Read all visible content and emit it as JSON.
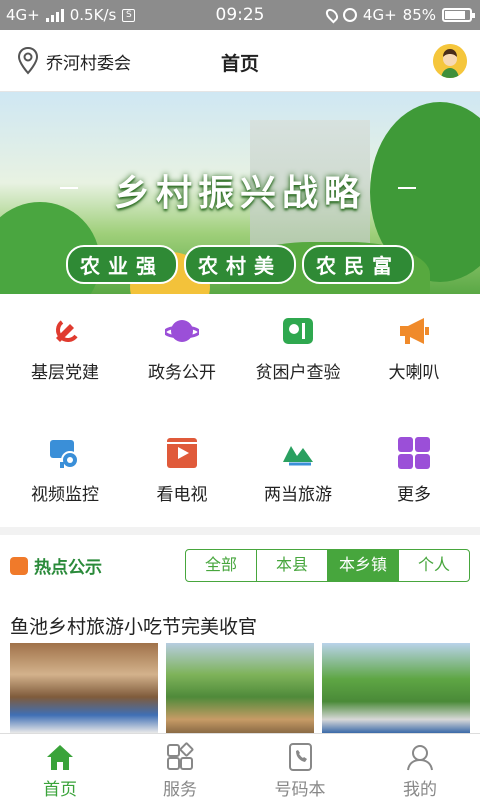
{
  "status_bar": {
    "network_left": "4G+",
    "speed": "0.5K/s",
    "speed_box": "S",
    "time": "09:25",
    "network_right": "4G+",
    "battery": "85%",
    "battery_level": 0.85
  },
  "header": {
    "location": "乔河村委会",
    "title": "首页"
  },
  "banner": {
    "headline": "乡村振兴战略",
    "slogans": [
      "农业强",
      "农村美",
      "农民富"
    ],
    "page_count": 2
  },
  "menu": [
    {
      "label": "基层党建",
      "icon": "party-emblem-icon",
      "color": "#e03b2f"
    },
    {
      "label": "政务公开",
      "icon": "planet-icon",
      "color": "#9b4fd8"
    },
    {
      "label": "贫困户查验",
      "icon": "ticket-icon",
      "color": "#2fa84f"
    },
    {
      "label": "大喇叭",
      "icon": "megaphone-icon",
      "color": "#f08a2a"
    },
    {
      "label": "视频监控",
      "icon": "camera-icon",
      "color": "#3a8fd8"
    },
    {
      "label": "看电视",
      "icon": "video-icon",
      "color": "#e05a3a"
    },
    {
      "label": "两当旅游",
      "icon": "tourism-logo-icon",
      "color": "#2aa060"
    },
    {
      "label": "更多",
      "icon": "grid-icon",
      "color": "#9b4fd8"
    }
  ],
  "hot": {
    "label": "热点公示",
    "tabs": [
      "全部",
      "本县",
      "本乡镇",
      "个人"
    ],
    "active_tab": "本乡镇",
    "news_title": "鱼池乡村旅游小吃节完美收官"
  },
  "bottom_nav": [
    {
      "label": "首页",
      "icon": "home-icon",
      "active": true
    },
    {
      "label": "服务",
      "icon": "services-icon",
      "active": false
    },
    {
      "label": "号码本",
      "icon": "phonebook-icon",
      "active": false
    },
    {
      "label": "我的",
      "icon": "profile-icon",
      "active": false
    }
  ],
  "colors": {
    "accent": "#3aa33a",
    "status_bar": "#8c8c8c"
  }
}
